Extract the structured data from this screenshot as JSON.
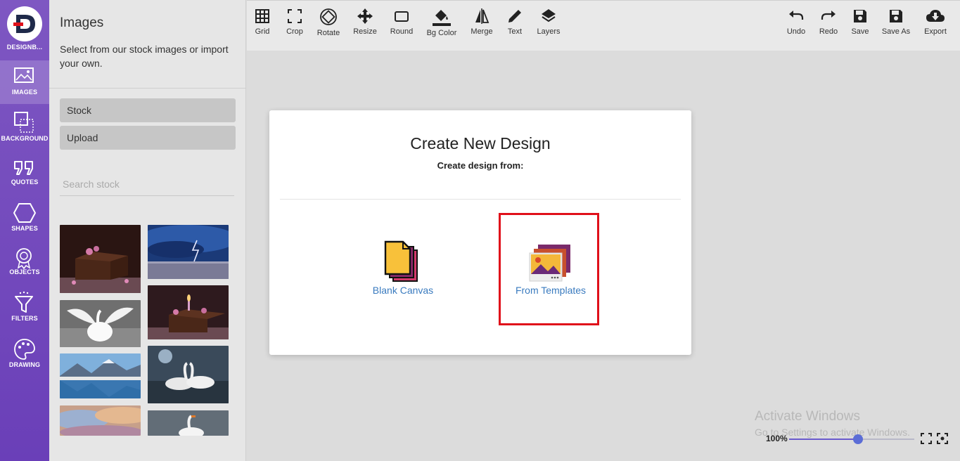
{
  "app": {
    "logo_text": "DESIGNB..."
  },
  "rail": {
    "items": [
      {
        "label": "IMAGES",
        "icon": "image-icon",
        "active": true
      },
      {
        "label": "BACKGROUND",
        "icon": "background-icon",
        "active": false
      },
      {
        "label": "QUOTES",
        "icon": "quote-icon",
        "active": false
      },
      {
        "label": "SHAPES",
        "icon": "hexagon-icon",
        "active": false
      },
      {
        "label": "OBJECTS",
        "icon": "badge-icon",
        "active": false
      },
      {
        "label": "FILTERS",
        "icon": "filter-icon",
        "active": false
      },
      {
        "label": "DRAWING",
        "icon": "palette-icon",
        "active": false
      }
    ]
  },
  "panel": {
    "title": "Images",
    "description": "Select from our stock images or import your own.",
    "stock_label": "Stock",
    "upload_label": "Upload",
    "search_placeholder": "Search stock",
    "thumbnails": [
      "cake-with-flowers",
      "lightning-storm-sea",
      "swan-spread-wings",
      "cake-with-candle",
      "mountain-lake",
      "swans-pair",
      "sunset-sky",
      "swan-on-water"
    ]
  },
  "toolbar": {
    "left": [
      {
        "label": "Grid",
        "icon": "grid-icon"
      },
      {
        "label": "Crop",
        "icon": "crop-icon"
      },
      {
        "label": "Rotate",
        "icon": "rotate-icon"
      },
      {
        "label": "Resize",
        "icon": "move-arrows-icon"
      },
      {
        "label": "Round",
        "icon": "rounded-rect-icon"
      },
      {
        "label": "Bg Color",
        "icon": "paint-bucket-icon"
      },
      {
        "label": "Merge",
        "icon": "merge-icon"
      },
      {
        "label": "Text",
        "icon": "pencil-icon"
      },
      {
        "label": "Layers",
        "icon": "layers-icon"
      }
    ],
    "right": [
      {
        "label": "Undo",
        "icon": "undo-icon"
      },
      {
        "label": "Redo",
        "icon": "redo-icon"
      },
      {
        "label": "Save",
        "icon": "save-icon"
      },
      {
        "label": "Save As",
        "icon": "save-as-icon"
      },
      {
        "label": "Export",
        "icon": "cloud-download-icon"
      }
    ]
  },
  "modal": {
    "title": "Create New Design",
    "subtitle": "Create design from:",
    "options": [
      {
        "label": "Blank Canvas",
        "icon": "blank-pages-icon"
      },
      {
        "label": "From Templates",
        "icon": "templates-icon",
        "highlighted": true
      }
    ]
  },
  "watermark": {
    "line1": "Activate Windows",
    "line2": "Go to Settings to activate Windows."
  },
  "zoom": {
    "value_label": "100%",
    "level_fraction": 0.55
  },
  "colors": {
    "accent": "#7e57c2",
    "link": "#3a7bbf",
    "highlight": "#e0101a"
  }
}
